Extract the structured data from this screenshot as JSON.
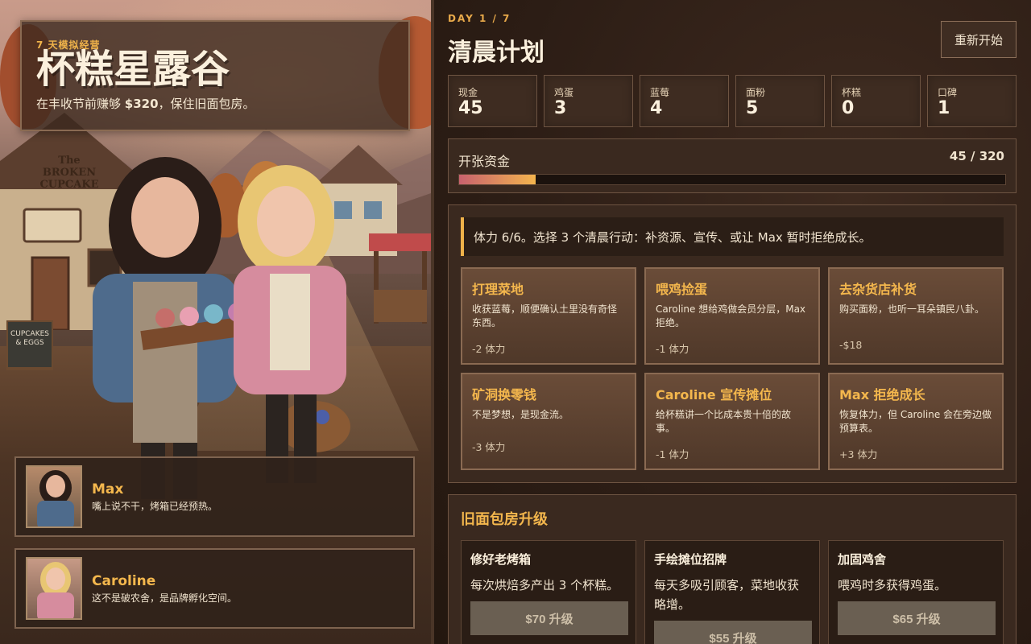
{
  "hero": {
    "kicker": "7 天模拟经营",
    "title": "杯糕星露谷",
    "subtitle_prefix": "在丰收节前赚够 ",
    "subtitle_amount": "$320",
    "subtitle_suffix": "，保住旧面包房。",
    "shop_sign": "The BROKEN CUPCAKE",
    "board_sign": "CUPCAKES & EGGS"
  },
  "characters": [
    {
      "name": "Max",
      "line": "嘴上说不干，烤箱已经预热。"
    },
    {
      "name": "Caroline",
      "line": "这不是破农舍，是品牌孵化空间。"
    }
  ],
  "header": {
    "day_label": "DAY 1 / 7",
    "title": "清晨计划",
    "restart_label": "重新开始"
  },
  "stats": [
    {
      "label": "现金",
      "value": "45"
    },
    {
      "label": "鸡蛋",
      "value": "3"
    },
    {
      "label": "蓝莓",
      "value": "4"
    },
    {
      "label": "面粉",
      "value": "5"
    },
    {
      "label": "杯糕",
      "value": "0"
    },
    {
      "label": "口碑",
      "value": "1"
    }
  ],
  "funds": {
    "label": "开张资金",
    "count_text": "45 / 320",
    "current": 45,
    "goal": 320
  },
  "energy_message": "体力 6/6。选择 3 个清晨行动：补资源、宣传、或让 Max 暂时拒绝成长。",
  "actions": [
    {
      "title": "打理菜地",
      "desc": "收获蓝莓，顺便确认土里没有奇怪东西。",
      "cost": "-2 体力"
    },
    {
      "title": "喂鸡捡蛋",
      "desc": "Caroline 想给鸡做会员分层，Max 拒绝。",
      "cost": "-1 体力"
    },
    {
      "title": "去杂货店补货",
      "desc": "购买面粉，也听一耳朵镇民八卦。",
      "cost": "-$18"
    },
    {
      "title": "矿洞换零钱",
      "desc": "不是梦想，是现金流。",
      "cost": "-3 体力"
    },
    {
      "title": "Caroline 宣传摊位",
      "desc": "给杯糕讲一个比成本贵十倍的故事。",
      "cost": "-1 体力"
    },
    {
      "title": "Max 拒绝成长",
      "desc": "恢复体力，但 Caroline 会在旁边做预算表。",
      "cost": "+3 体力"
    }
  ],
  "upgrades": {
    "title": "旧面包房升级",
    "items": [
      {
        "name": "修好老烤箱",
        "desc": "每次烘焙多产出 3 个杯糕。",
        "button": "$70 升级"
      },
      {
        "name": "手绘摊位招牌",
        "desc": "每天多吸引顾客，菜地收获略增。",
        "button": "$55 升级"
      },
      {
        "name": "加固鸡舍",
        "desc": "喂鸡时多获得鸡蛋。",
        "button": "$65 升级"
      }
    ]
  },
  "colors": {
    "accent": "#f4b74d",
    "panel": "#3a291f",
    "border": "#6e5442",
    "progress_start": "#c8626e",
    "progress_end": "#f3b44e"
  }
}
